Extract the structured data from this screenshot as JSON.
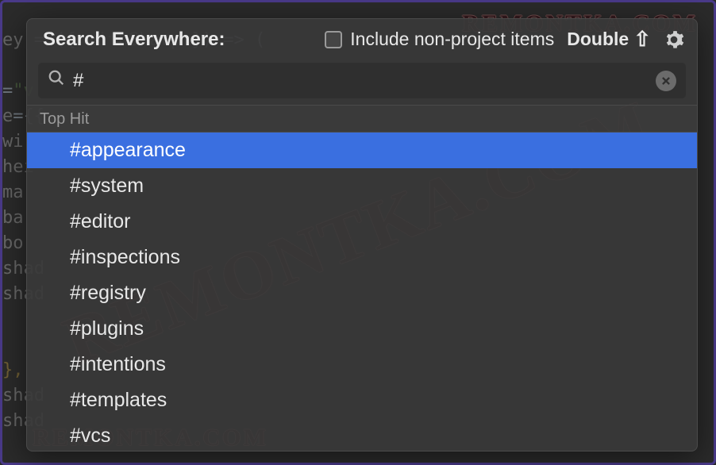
{
  "header": {
    "title": "Search Everywhere:",
    "include_label": "Include non-project items",
    "hint_text": "Double",
    "shift_symbol": "⇧"
  },
  "search": {
    "value": "#",
    "placeholder": ""
  },
  "section_label": "Top Hit",
  "results": [
    "#appearance",
    "#system",
    "#editor",
    "#inspections",
    "#registry",
    "#plugins",
    "#intentions",
    "#templates",
    "#vcs"
  ],
  "selected_index": 0,
  "watermark": "REMONTKA.COM",
  "code_lines": [
    "ey = ({ withSharp }) => (",
    "",
    "=\"v",
    "e={{",
    "wi",
    "hei",
    "ma",
    "ba",
    "bo",
    "shad",
    "shad",
    "",
    "",
    "",
    "},",
    "shad",
    "shad"
  ]
}
